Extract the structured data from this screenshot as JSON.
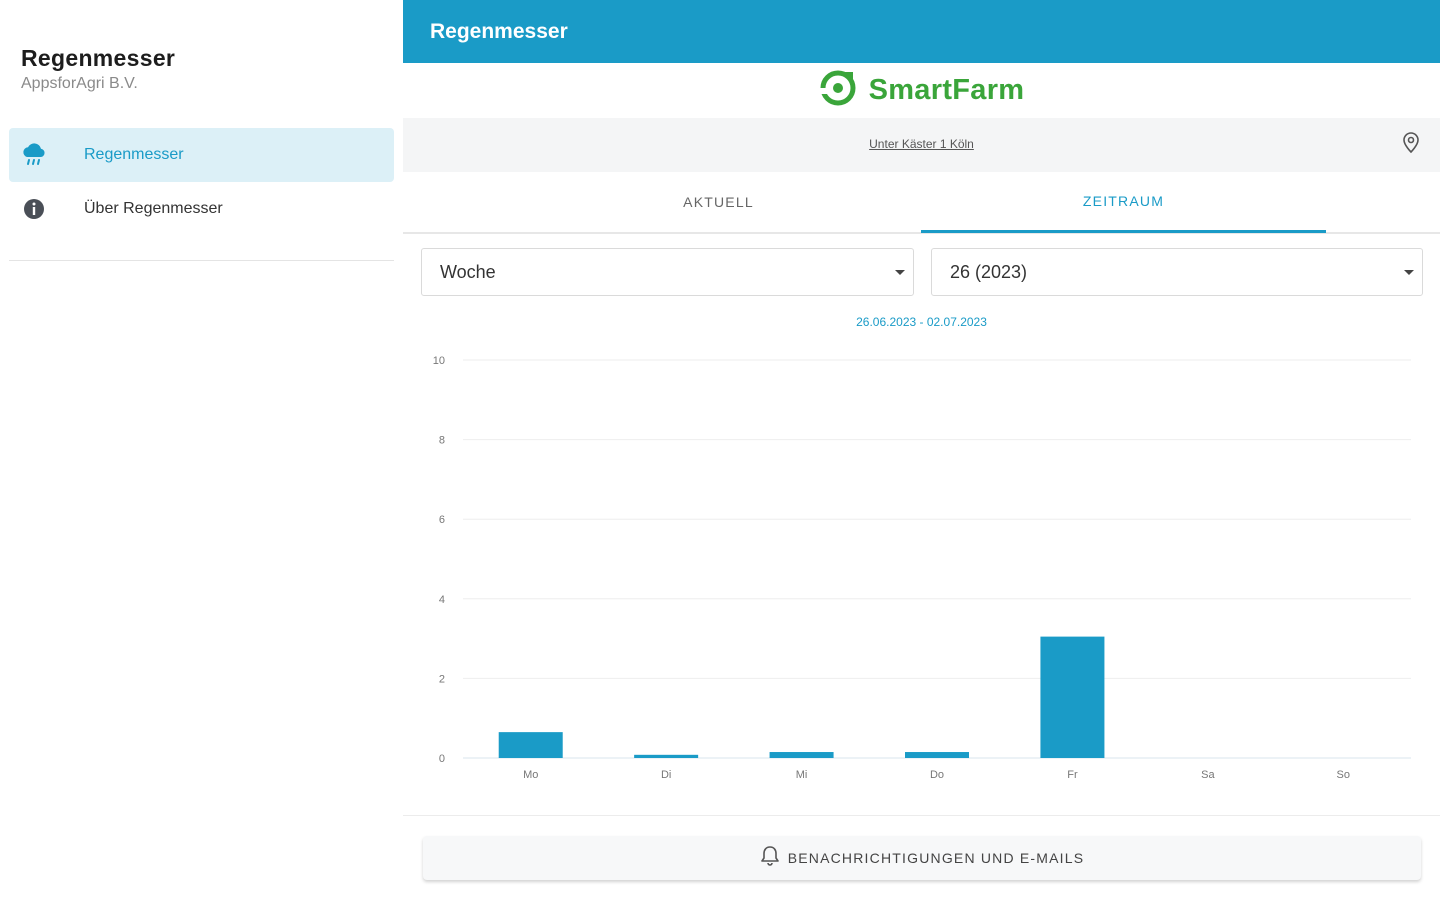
{
  "sidebar": {
    "title": "Regenmesser",
    "subtitle": "AppsforAgri B.V.",
    "items": [
      {
        "label": "Regenmesser",
        "icon": "rain-cloud-icon",
        "active": true
      },
      {
        "label": "Über Regenmesser",
        "icon": "info-icon",
        "active": false
      }
    ]
  },
  "header": {
    "title": "Regenmesser"
  },
  "brand": {
    "name": "SmartFarm",
    "color": "#3aa53a"
  },
  "location": {
    "text": "Unter Käster 1 Köln",
    "icon": "map-pin-icon"
  },
  "tabs": [
    {
      "label": "AKTUELL",
      "active": false
    },
    {
      "label": "ZEITRAUM",
      "active": true
    }
  ],
  "filters": {
    "period": "Woche",
    "week": "26 (2023)"
  },
  "date_range": "26.06.2023 - 02.07.2023",
  "chart_data": {
    "type": "bar",
    "categories": [
      "Mo",
      "Di",
      "Mi",
      "Do",
      "Fr",
      "Sa",
      "So"
    ],
    "values": [
      0.65,
      0.08,
      0.15,
      0.15,
      3.05,
      0,
      0
    ],
    "ylim": [
      0,
      10
    ],
    "yticks": [
      0,
      2,
      4,
      6,
      8,
      10
    ],
    "grid": true,
    "bar_color": "#1a9bc7",
    "xlabel": "",
    "ylabel": ""
  },
  "notify_button": {
    "label": "BENACHRICHTIGUNGEN UND E-MAILS",
    "icon": "bell-icon"
  },
  "colors": {
    "accent": "#1a9bc7",
    "active_bg": "#dcf0f7"
  }
}
